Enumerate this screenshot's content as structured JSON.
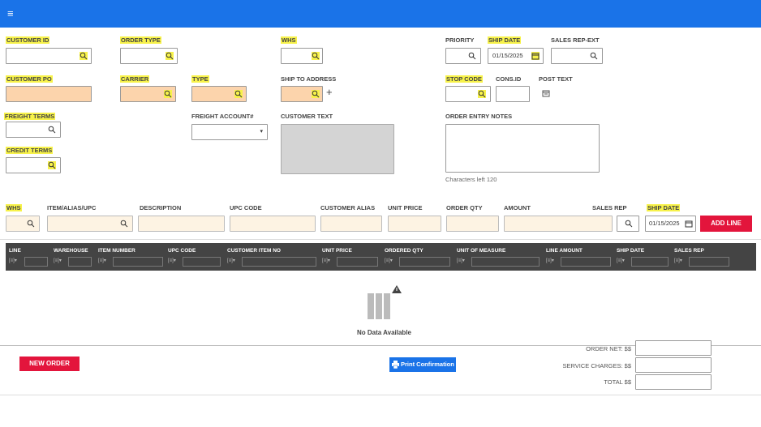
{
  "header": {
    "menu_icon": "hamburger-icon"
  },
  "form": {
    "customer_id": "CUSTOMER ID",
    "order_type": "ORDER TYPE",
    "whs": "WHS",
    "priority": "PRIORITY",
    "ship_date": "SHIP DATE",
    "ship_date_value": "01/15/2025",
    "sales_rep_ext": "SALES REP-EXT",
    "customer_po": "CUSTOMER PO",
    "carrier": "CARRIER",
    "type": "TYPE",
    "ship_to_address": "SHIP TO ADDRESS",
    "stop_code": "STOP CODE",
    "cons_id": "CONS.ID",
    "post_text": "POST TEXT",
    "freight_terms": "FREIGHT TERMS",
    "freight_account": "FREIGHT ACCOUNT#",
    "customer_text": "CUSTOMER TEXT",
    "order_entry_notes": "ORDER ENTRY NOTES",
    "chars_left": "Characters left 120",
    "credit_terms": "CREDIT TERMS"
  },
  "line_entry": {
    "whs": "WHS",
    "item": "ITEM/ALIAS/UPC",
    "description": "DESCRIPTION",
    "upc_code": "UPC CODE",
    "customer_alias": "CUSTOMER ALIAS",
    "unit_price": "UNIT PRICE",
    "order_qty": "ORDER QTY",
    "amount": "AMOUNT",
    "sales_rep": "SALES REP",
    "ship_date": "SHIP DATE",
    "ship_date_value": "01/15/2025",
    "add_line": "ADD LINE"
  },
  "grid": {
    "columns": [
      "LINE",
      "WAREHOUSE",
      "ITEM NUMBER",
      "UPC CODE",
      "CUSTOMER ITEM NO",
      "UNIT PRICE",
      "ORDERED QTY",
      "UNIT OF MEASURE",
      "LINE AMOUNT",
      "SHIP DATE",
      "SALES REP"
    ],
    "filter_glyph": "[≡] ▾",
    "empty_text": "No Data Available"
  },
  "footer": {
    "new_order": "NEW ORDER",
    "print_confirmation": "Print Confirmation",
    "order_net": "ORDER NET: $$",
    "service_charges": "SERVICE CHARGES: $$",
    "total": "TOTAL $$"
  },
  "colors": {
    "accent": "#1a73e8",
    "danger": "#e3153c",
    "highlight": "#f7f24a",
    "peach": "#fcd4ac"
  }
}
